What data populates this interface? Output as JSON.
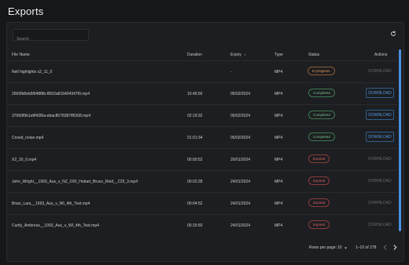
{
  "page": {
    "title": "Exports"
  },
  "search": {
    "placeholder": "Search"
  },
  "columns": {
    "file_name": "File Name",
    "duration": "Duration",
    "expiry": "Expiry",
    "type": "Type",
    "status": "Status",
    "actions": "Actions"
  },
  "sort_indicator": "↓",
  "rows": [
    {
      "file_name": "Neil highlights x2_11_0",
      "duration": "",
      "expiry": "-",
      "type": "MP4",
      "status": "In progress",
      "status_kind": "progress",
      "action": "DOWNLOAD",
      "action_enabled": false
    },
    {
      "file_name": "2665fb8eb5f948f8b-8002a816404347f0.mp4",
      "duration": "10:45:56",
      "expiry": "05/02/2024",
      "type": "MP4",
      "status": "Completed",
      "status_kind": "completed",
      "action": "DOWNLOAD",
      "action_enabled": true
    },
    {
      "file_name": "37969f9b1e8f42f6a-ebac8078387ff6308.mp4",
      "duration": "02:19:32",
      "expiry": "05/02/2024",
      "type": "MP4",
      "status": "Completed",
      "status_kind": "completed",
      "action": "DOWNLOAD",
      "action_enabled": true
    },
    {
      "file_name": "Crowd_noise.mp4",
      "duration": "01:01:34",
      "expiry": "05/02/2024",
      "type": "MP4",
      "status": "Completed",
      "status_kind": "completed",
      "action": "DOWNLOAD",
      "action_enabled": true
    },
    {
      "file_name": "X2_10_0.mp4",
      "duration": "00:00:52",
      "expiry": "26/01/2024",
      "type": "MP4",
      "status": "Expired",
      "status_kind": "expired",
      "action": "DOWNLOAD",
      "action_enabled": false
    },
    {
      "file_name": "John_Wright__1993_Aus_v_NZ_ODI_Hobart_Bruce_Reid__CDI_3.mp4",
      "duration": "00:02:28",
      "expiry": "24/01/2024",
      "type": "MP4",
      "status": "Expired",
      "status_kind": "expired",
      "action": "DOWNLOAD",
      "action_enabled": false
    },
    {
      "file_name": "Brian_Lara__1993_Aus_v_WI_4th_Test.mp4",
      "duration": "00:04:52",
      "expiry": "24/01/2024",
      "type": "MP4",
      "status": "Expired",
      "status_kind": "expired",
      "action": "DOWNLOAD",
      "action_enabled": false
    },
    {
      "file_name": "Curtly_Ambrose__1993_Aus_v_WI_4th_Test.mp4",
      "duration": "00:16:50",
      "expiry": "24/01/2024",
      "type": "MP4",
      "status": "Expired",
      "status_kind": "expired",
      "action": "DOWNLOAD",
      "action_enabled": false
    }
  ],
  "pagination": {
    "rows_label": "Rows per page:",
    "rows_value": "10",
    "range": "1–10 of 278"
  },
  "colors": {
    "accent": "#4d9be6",
    "progress": "#e89a54",
    "completed": "#6cc28a",
    "expired": "#e06060"
  },
  "icons": {
    "refresh": "refresh-icon",
    "sort": "arrow-down-icon",
    "rows_dropdown": "caret-down-icon",
    "prev": "chevron-left-icon",
    "next": "chevron-right-icon"
  }
}
